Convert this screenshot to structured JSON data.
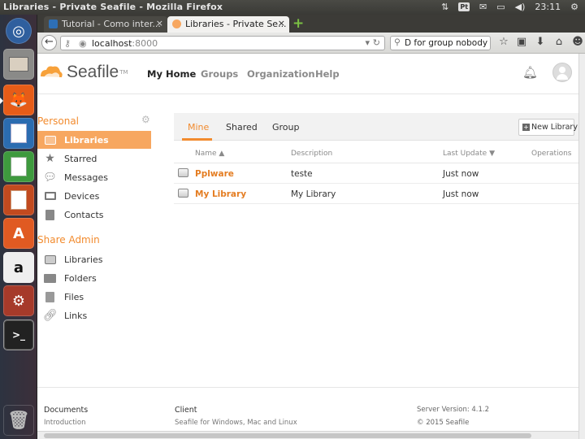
{
  "system_bar": {
    "window_title": "Libraries - Private Seafile - Mozilla Firefox",
    "lang": "Pt",
    "time": "23:11"
  },
  "browser": {
    "tabs": [
      {
        "label": "Tutorial - Como inter...",
        "close": "×"
      },
      {
        "label": "Libraries - Private Se...",
        "close": "×"
      }
    ],
    "new_tab": "+",
    "url_host": "localhost",
    "url_port": ":8000",
    "search_value": "D for group nobody"
  },
  "header": {
    "logo_text": "Seafile",
    "logo_tm": "TM",
    "nav": [
      "My Home",
      "Groups",
      "Organization",
      "Help"
    ]
  },
  "sidebar": {
    "personal_title": "Personal",
    "personal_items": [
      {
        "label": "Libraries",
        "icon": "libraries-icon"
      },
      {
        "label": "Starred",
        "icon": "star-icon"
      },
      {
        "label": "Messages",
        "icon": "messages-icon"
      },
      {
        "label": "Devices",
        "icon": "monitor-icon"
      },
      {
        "label": "Contacts",
        "icon": "contacts-icon"
      }
    ],
    "share_title": "Share Admin",
    "share_items": [
      {
        "label": "Libraries",
        "icon": "libraries-icon"
      },
      {
        "label": "Folders",
        "icon": "folder-icon"
      },
      {
        "label": "Files",
        "icon": "file-icon"
      },
      {
        "label": "Links",
        "icon": "link-icon"
      }
    ]
  },
  "main": {
    "tabs": [
      "Mine",
      "Shared",
      "Group"
    ],
    "new_library": "New Library",
    "columns": {
      "name": "Name ▲",
      "description": "Description",
      "last_update": "Last Update ▼",
      "operations": "Operations"
    },
    "rows": [
      {
        "name": "Pplware",
        "description": "teste",
        "last_update": "Just now"
      },
      {
        "name": "My Library",
        "description": "My Library",
        "last_update": "Just now"
      }
    ]
  },
  "footer": {
    "documents_title": "Documents",
    "documents_link": "Introduction",
    "client_title": "Client",
    "client_text": "Seafile for Windows, Mac and Linux",
    "server_version": "Server Version: 4.1.2",
    "copyright": "© 2015 Seafile"
  },
  "colors": {
    "accent": "#f28b2e",
    "active_sidebar": "#f7a760"
  }
}
